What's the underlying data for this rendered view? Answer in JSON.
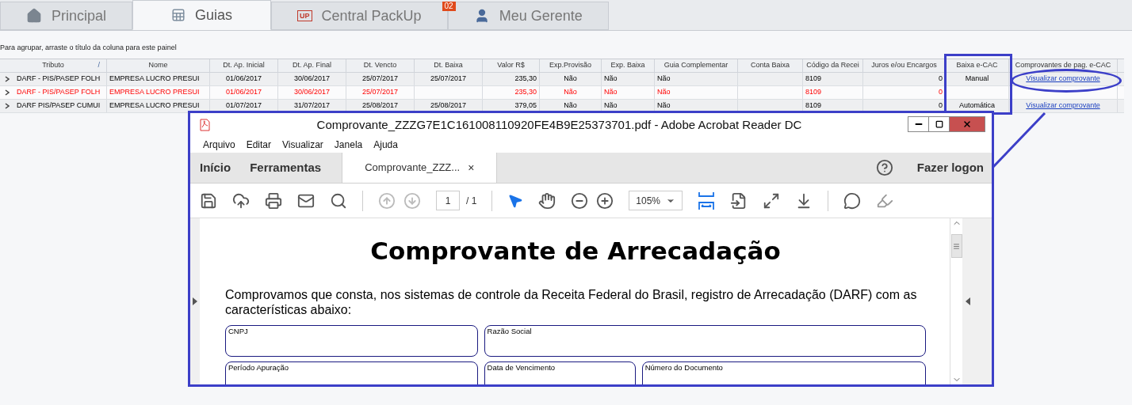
{
  "tabs": [
    {
      "label": "Principal",
      "selected": false
    },
    {
      "label": "Guias",
      "selected": true
    },
    {
      "label": "Central PackUp",
      "logo_text": "UP",
      "badge": "02",
      "selected": false
    },
    {
      "label": "Meu Gerente",
      "selected": false
    }
  ],
  "group_hint": "Para agrupar, arraste o título da coluna para este painel",
  "table": {
    "columns": [
      {
        "label": "Tributo",
        "sort_mark": "/",
        "kind": "text"
      },
      {
        "label": "Nome",
        "kind": "text"
      },
      {
        "label": "Dt. Ap. Inicial",
        "kind": "center"
      },
      {
        "label": "Dt. Ap. Final",
        "kind": "center"
      },
      {
        "label": "Dt. Vencto",
        "kind": "center"
      },
      {
        "label": "Dt. Baixa",
        "kind": "center"
      },
      {
        "label": "Valor R$",
        "kind": "number"
      },
      {
        "label": "Exp.Provisão",
        "kind": "center"
      },
      {
        "label": "Exp. Baixa",
        "kind": "text"
      },
      {
        "label": "Guia Complementar",
        "kind": "text"
      },
      {
        "label": "Conta Baixa",
        "kind": "text"
      },
      {
        "label": "Código da Recei",
        "kind": "text"
      },
      {
        "label": "Juros e/ou Encargos",
        "kind": "number"
      },
      {
        "label": "Baixa e-CAC",
        "kind": "center"
      },
      {
        "label": "Comprovantes de pag. e-CAC",
        "kind": "link"
      }
    ],
    "rows": [
      {
        "flagged": false,
        "cells": [
          "DARF - PIS/PASEP FOLH",
          "EMPRESA LUCRO PRESUI",
          "01/06/2017",
          "30/06/2017",
          "25/07/2017",
          "25/07/2017",
          "235,30",
          "Não",
          "Não",
          "Não",
          null,
          "8109",
          "0",
          "Manual",
          "Visualizar comprovante"
        ]
      },
      {
        "flagged": true,
        "cells": [
          "DARF - PIS/PASEP FOLH",
          "EMPRESA LUCRO PRESUI",
          "01/06/2017",
          "30/06/2017",
          "25/07/2017",
          null,
          "235,30",
          "Não",
          "Não",
          "Não",
          null,
          "8109",
          "0",
          null,
          null
        ]
      },
      {
        "flagged": false,
        "cells": [
          "DARF PIS/PASEP CUMUI",
          "EMPRESA LUCRO PRESUI",
          "01/07/2017",
          "31/07/2017",
          "25/08/2017",
          "25/08/2017",
          "379,05",
          "Não",
          "Não",
          "Não",
          null,
          "8109",
          "0",
          "Automática",
          "Visualizar comprovante"
        ]
      }
    ]
  },
  "acrobat": {
    "title": "Comprovante_ZZZG7E1C161008110920FE4B9E25373701.pdf - Adobe Acrobat Reader DC",
    "menu": [
      "Arquivo",
      "Editar",
      "Visualizar",
      "Janela",
      "Ajuda"
    ],
    "nav": [
      "Início",
      "Ferramentas"
    ],
    "doc_tab": {
      "label": "Comprovante_ZZZ...",
      "close": "×"
    },
    "login": "Fazer logon",
    "page": "1",
    "page_total": "/ 1",
    "zoom": "105%",
    "document": {
      "title": "Comprovante de Arrecadação",
      "text": "Comprovamos que consta, nos sistemas de controle da Receita Federal do Brasil, registro de Arrecadação (DARF) com as características abaixo:",
      "field_rows": [
        [
          "CNPJ",
          "Razão Social"
        ],
        [
          "Período Apuração",
          "Data de Vencimento",
          "Número do Documento"
        ]
      ]
    }
  }
}
